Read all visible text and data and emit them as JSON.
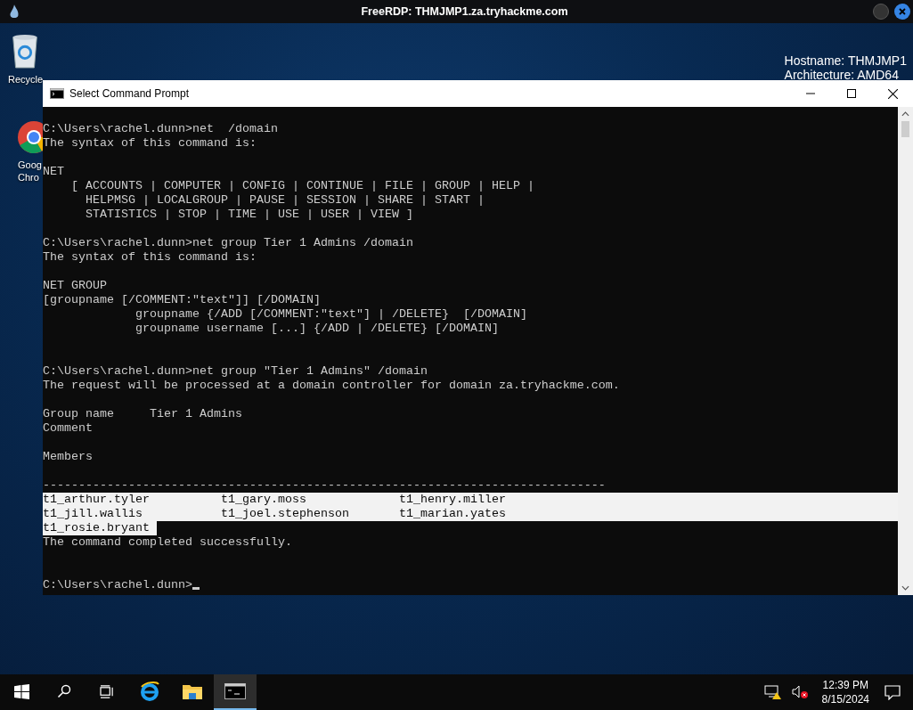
{
  "rdp_bar": {
    "title": "FreeRDP: THMJMP1.za.tryhackme.com"
  },
  "desktop": {
    "icons": [
      {
        "kind": "recycle",
        "label": "Recycle"
      },
      {
        "kind": "chrome",
        "label": "Goog",
        "label_2": "Chro"
      }
    ],
    "info": [
      "Hostname: THMJMP1",
      "Architecture: AMD64"
    ]
  },
  "console": {
    "title": "Select Command Prompt",
    "lines": [
      {
        "kind": "text",
        "text": "C:\\Users\\rachel.dunn>net  /domain"
      },
      {
        "kind": "text",
        "text": "The syntax of this command is:"
      },
      {
        "kind": "blank"
      },
      {
        "kind": "text",
        "text": "NET"
      },
      {
        "kind": "text",
        "text": "    [ ACCOUNTS | COMPUTER | CONFIG | CONTINUE | FILE | GROUP | HELP |"
      },
      {
        "kind": "text",
        "text": "      HELPMSG | LOCALGROUP | PAUSE | SESSION | SHARE | START |"
      },
      {
        "kind": "text",
        "text": "      STATISTICS | STOP | TIME | USE | USER | VIEW ]"
      },
      {
        "kind": "blank"
      },
      {
        "kind": "text",
        "text": "C:\\Users\\rachel.dunn>net group Tier 1 Admins /domain"
      },
      {
        "kind": "text",
        "text": "The syntax of this command is:"
      },
      {
        "kind": "blank"
      },
      {
        "kind": "text",
        "text": "NET GROUP"
      },
      {
        "kind": "text",
        "text": "[groupname [/COMMENT:\"text\"]] [/DOMAIN]"
      },
      {
        "kind": "text",
        "text": "             groupname {/ADD [/COMMENT:\"text\"] | /DELETE}  [/DOMAIN]"
      },
      {
        "kind": "text",
        "text": "             groupname username [...] {/ADD | /DELETE} [/DOMAIN]"
      },
      {
        "kind": "blank"
      },
      {
        "kind": "blank"
      },
      {
        "kind": "text",
        "text": "C:\\Users\\rachel.dunn>net group \"Tier 1 Admins\" /domain"
      },
      {
        "kind": "text",
        "text": "The request will be processed at a domain controller for domain za.tryhackme.com."
      },
      {
        "kind": "blank"
      },
      {
        "kind": "text",
        "text": "Group name     Tier 1 Admins"
      },
      {
        "kind": "text",
        "text": "Comment"
      },
      {
        "kind": "blank"
      },
      {
        "kind": "text",
        "text": "Members"
      },
      {
        "kind": "blank"
      },
      {
        "kind": "text",
        "text": "-------------------------------------------------------------------------------"
      },
      {
        "kind": "selected-row",
        "text": "t1_arthur.tyler          t1_gary.moss             t1_henry.miller"
      },
      {
        "kind": "selected-row",
        "text": "t1_jill.wallis           t1_joel.stephenson       t1_marian.yates"
      },
      {
        "kind": "selected-text",
        "text": "t1_rosie.bryant "
      },
      {
        "kind": "text",
        "text": "The command completed successfully."
      },
      {
        "kind": "blank"
      },
      {
        "kind": "blank"
      },
      {
        "kind": "prompt",
        "text": "C:\\Users\\rachel.dunn>"
      }
    ]
  },
  "taskbar": {
    "items": [
      {
        "kind": "start",
        "active": false
      },
      {
        "kind": "search",
        "active": false
      },
      {
        "kind": "taskview",
        "active": false
      },
      {
        "kind": "ie",
        "active": false
      },
      {
        "kind": "explorer",
        "active": false
      },
      {
        "kind": "cmd",
        "active": true
      }
    ],
    "time": "12:39 PM",
    "date": "8/15/2024"
  }
}
